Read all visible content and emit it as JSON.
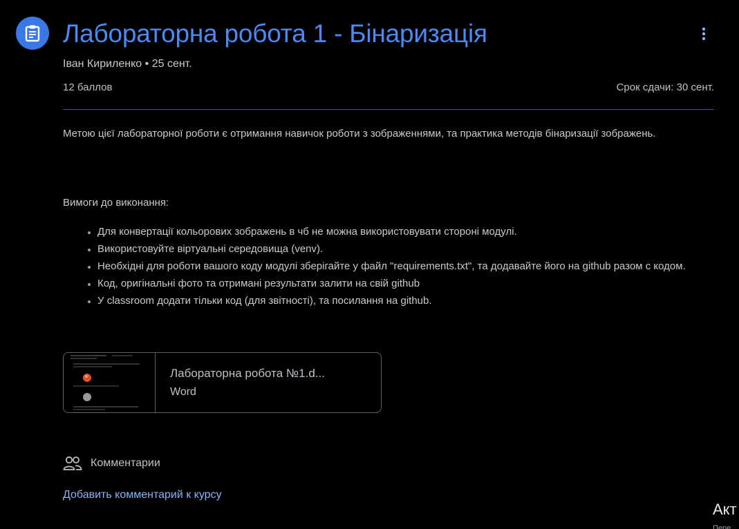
{
  "assignment": {
    "icon": "assignment-icon",
    "title": "Лабораторна робота 1 - Бінаризація",
    "author": "Іван Кириленко",
    "separator": "•",
    "posted": "25 сент.",
    "points": "12 баллов",
    "due": "Срок сдачи: 30 сент.",
    "more_icon": "more-vert-icon"
  },
  "description": "Метою цієї лабораторної роботи є отримання навичок роботи з зображеннями, та практика методів бінаризації зображень.",
  "requirements": {
    "title": "Вимоги до виконання:",
    "items": [
      "Для конвертації кольорових зображень в чб не можна використовувати стороні модулі.",
      "Використовуйте віртуальні середовища (venv).",
      "Необхідні для роботи вашого коду модулі зберігайте у файл \"requirements.txt\", та додавайте його на github разом с кодом.",
      "Код, оригінальні фото та отримані результати залити на свій github",
      "У classroom додати тільки код (для звітності), та посилання на github."
    ]
  },
  "attachment": {
    "name": "Лабораторна робота №1.d...",
    "type": "Word"
  },
  "comments": {
    "icon": "people-icon",
    "label": "Комментарии",
    "add_link": "Добавить комментарий к курсу"
  },
  "overlay": {
    "corner_text": "Акт",
    "corner_sub": "Пере"
  },
  "colors": {
    "accent": "#4a8af4",
    "icon_bg": "#3b78e7",
    "link": "#8ab4f8",
    "background": "#000000"
  }
}
